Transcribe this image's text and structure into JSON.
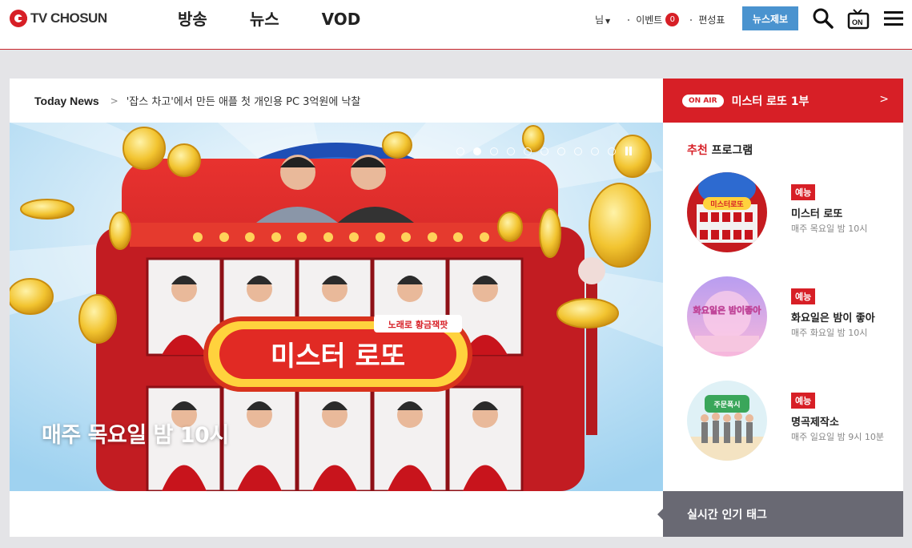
{
  "header": {
    "logo_text": "TV CHOSUN",
    "nav": [
      "방송",
      "뉴스",
      "VOD"
    ],
    "user_label": "님",
    "event_label": "이벤트",
    "event_count": "0",
    "schedule_label": "편성표",
    "report_label": "뉴스제보",
    "onair_icon_label": "ON"
  },
  "today_news": {
    "label": "Today News",
    "headline": "'잡스 차고'에서 만든 애플 첫 개인용 PC 3억원에 낙찰"
  },
  "banner": {
    "caption": "매주 목요일 밤 10시",
    "show_logo": "미스터 로또",
    "logo_tag": "노래로 황금잭팟",
    "slide_count": 11,
    "active_slide": 2
  },
  "onair": {
    "pill": "ON AIR",
    "title": "미스터 로또 1부"
  },
  "recommend": {
    "title_accent": "추천",
    "title_rest": "프로그램",
    "programs": [
      {
        "genre": "예능",
        "name": "미스터 로또",
        "time": "매주 목요일 밤 10시",
        "thumb_text": "미스터로또"
      },
      {
        "genre": "예능",
        "name": "화요일은 밤이 좋아",
        "time": "매주 화요일 밤 10시",
        "thumb_text": "화요일은 밤이좋아"
      },
      {
        "genre": "예능",
        "name": "명곡제작소",
        "time": "매주 일요일 밤 9시 10분",
        "thumb_text": "주문폭시"
      }
    ]
  },
  "tags": {
    "label": "실시간 인기 태그"
  },
  "colors": {
    "brand_red": "#d71f26",
    "report_blue": "#4a93cf",
    "tags_bg": "#696973"
  }
}
